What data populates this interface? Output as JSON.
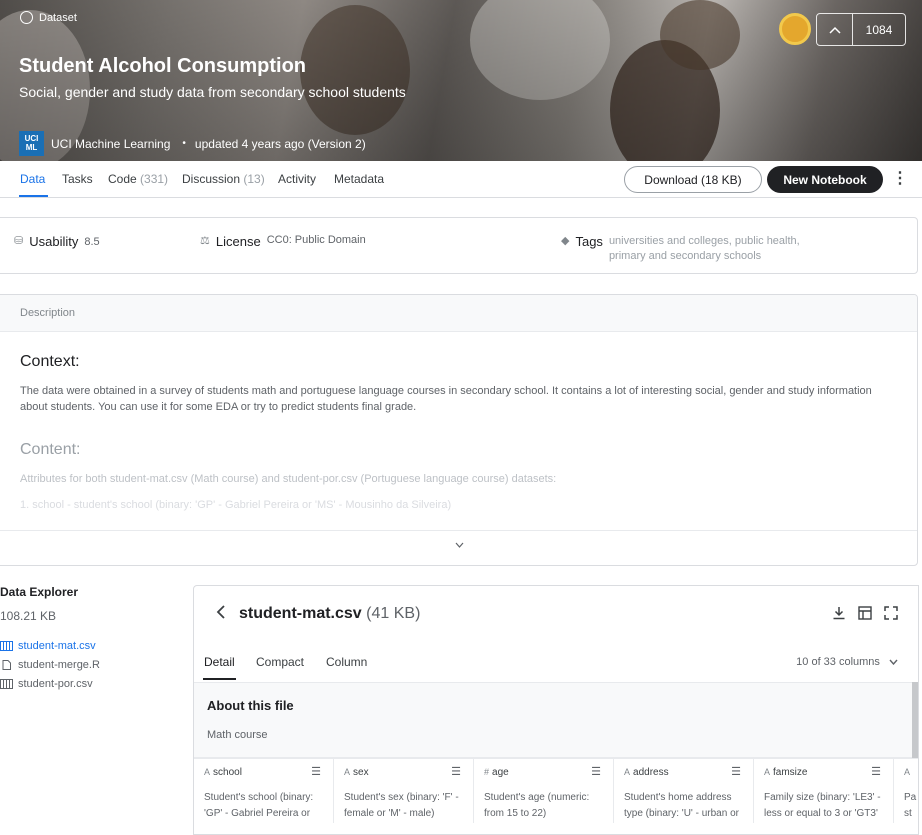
{
  "hero": {
    "type_label": "Dataset",
    "title": "Student Alcohol Consumption",
    "subtitle": "Social, gender and study data from secondary school students",
    "org_logo_line1": "UCI",
    "org_logo_line2": "ML",
    "org_name": "UCI Machine Learning",
    "updated": "updated 4 years ago (Version 2)",
    "vote_count": "1084",
    "medal_color": "#e4a72d"
  },
  "tabs": [
    {
      "label": "Data",
      "count": ""
    },
    {
      "label": "Tasks",
      "count": ""
    },
    {
      "label": "Code",
      "count": "(331)"
    },
    {
      "label": "Discussion",
      "count": "(13)"
    },
    {
      "label": "Activity",
      "count": ""
    },
    {
      "label": "Metadata",
      "count": ""
    }
  ],
  "actions": {
    "download": "Download (18 KB)",
    "new_notebook": "New Notebook"
  },
  "meta": {
    "usability_label": "Usability",
    "usability_value": "8.5",
    "license_label": "License",
    "license_value": "CC0: Public Domain",
    "tags_label": "Tags",
    "tags_value": "universities and colleges, public health, primary and secondary schools"
  },
  "description": {
    "header": "Description",
    "context_heading": "Context:",
    "context_text": "The data were obtained in a survey of students math and portuguese language courses in secondary school. It contains a lot of interesting social, gender and study information about students. You can use it for some EDA or try to predict students final grade.",
    "content_heading": "Content:",
    "content_text": "Attributes for both student-mat.csv (Math course) and student-por.csv (Portuguese language course) datasets:",
    "content_item1": "1. school - student's school (binary: 'GP' - Gabriel Pereira or 'MS' - Mousinho da Silveira)"
  },
  "explorer": {
    "title": "Data Explorer",
    "size": "108.21 KB",
    "files": [
      {
        "name": "student-mat.csv",
        "icon": "table-icon"
      },
      {
        "name": "student-merge.R",
        "icon": "file-icon"
      },
      {
        "name": "student-por.csv",
        "icon": "table-icon"
      }
    ]
  },
  "viewer": {
    "file_name": "student-mat.csv",
    "file_size": "(41 KB)",
    "tabs": [
      "Detail",
      "Compact",
      "Column"
    ],
    "columns_info": "10 of 33 columns",
    "about_title": "About this file",
    "about_text": "Math course",
    "columns": [
      {
        "type": "A",
        "name": "school",
        "desc": "Student's school (binary: 'GP' - Gabriel Pereira or"
      },
      {
        "type": "A",
        "name": "sex",
        "desc": "Student's sex (binary: 'F' - female or 'M' - male)"
      },
      {
        "type": "#",
        "name": "age",
        "desc": "Student's age (numeric: from 15 to 22)"
      },
      {
        "type": "A",
        "name": "address",
        "desc": "Student's home address type (binary: 'U' - urban or"
      },
      {
        "type": "A",
        "name": "famsize",
        "desc": "Family size (binary: 'LE3' - less or equal to 3 or 'GT3'"
      },
      {
        "type": "A",
        "name": "",
        "desc": "Pa st"
      }
    ]
  }
}
